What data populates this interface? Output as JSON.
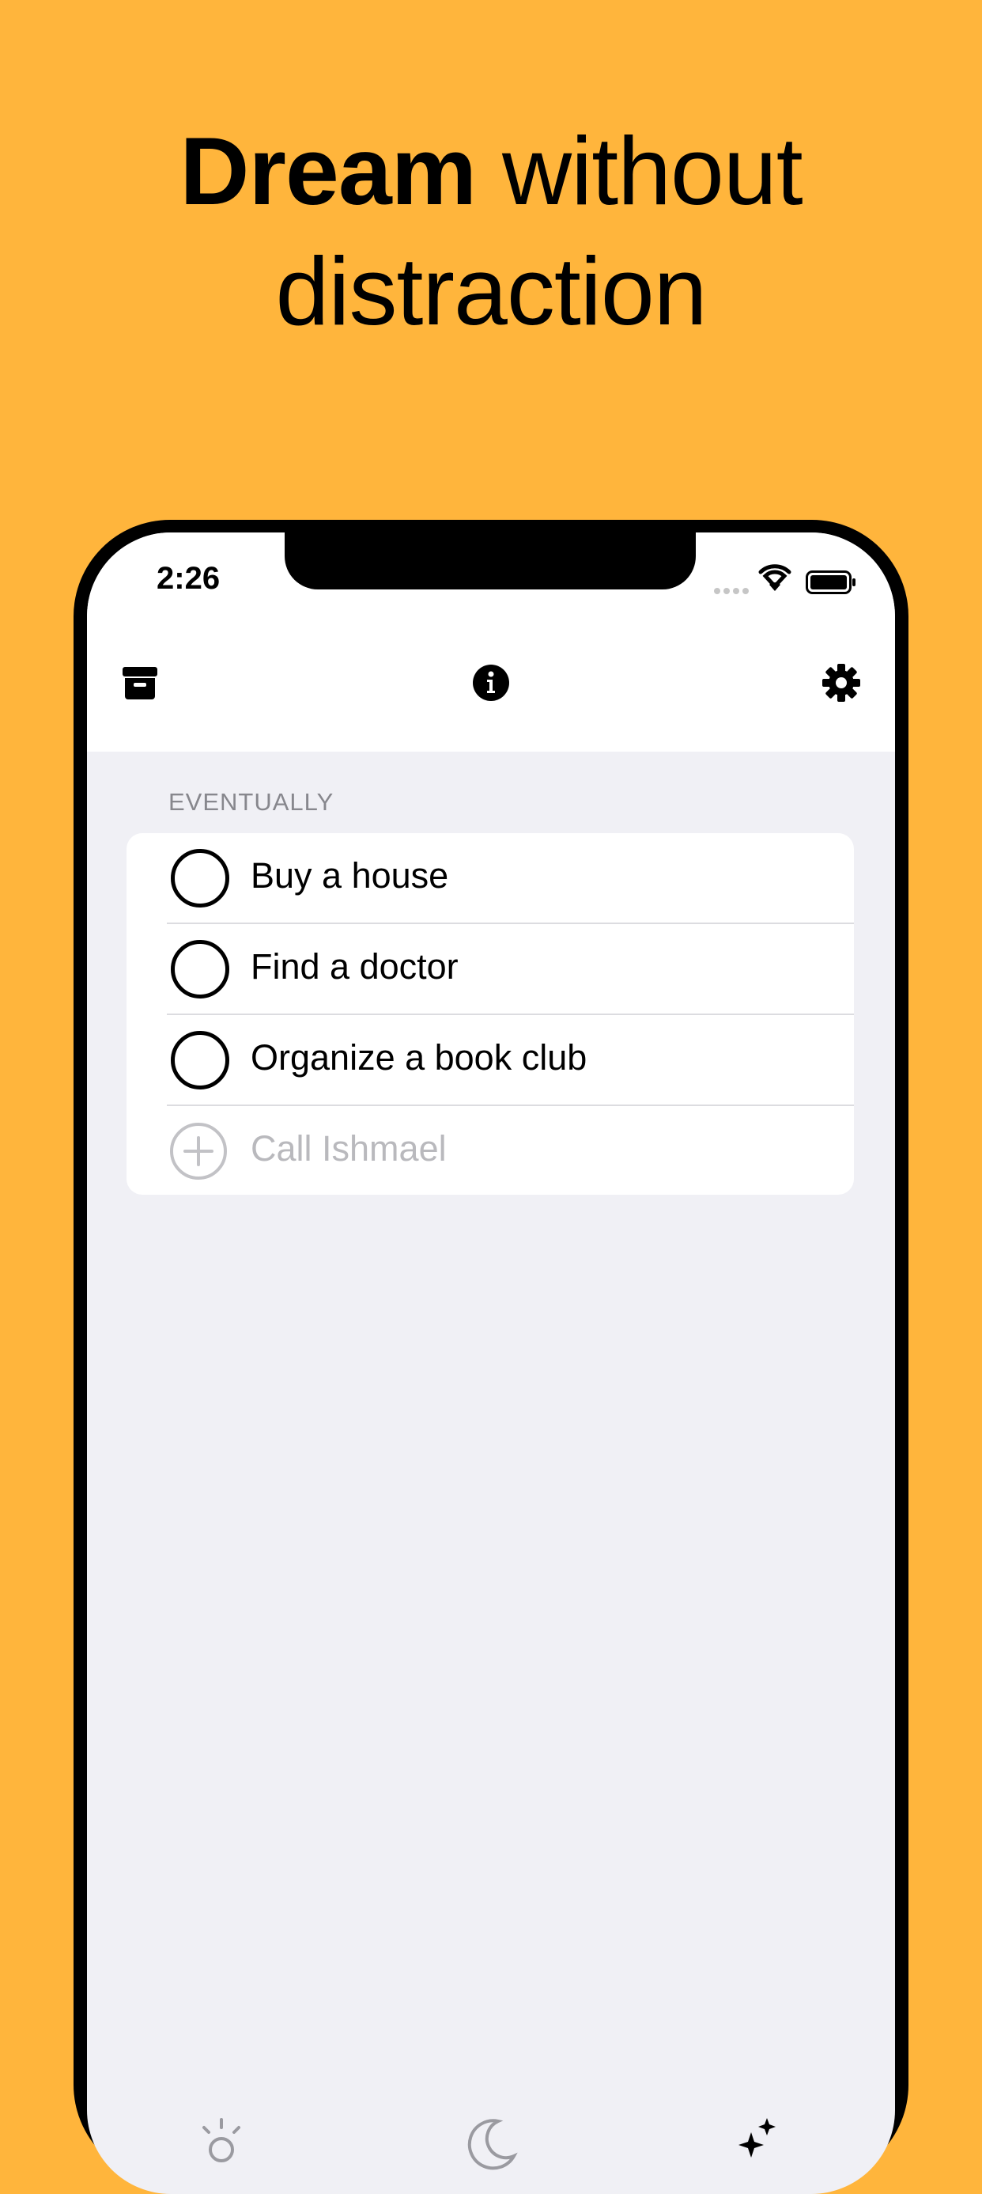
{
  "headline": {
    "bold": "Dream",
    "rest": " without distraction"
  },
  "status_bar": {
    "time": "2:26"
  },
  "toolbar": {
    "left_icon": "archive-box-icon",
    "center_icon": "info-circle-icon",
    "right_icon": "gear-icon"
  },
  "section": {
    "header": "EVENTUALLY",
    "items": [
      {
        "label": "Buy a house"
      },
      {
        "label": "Find a doctor"
      },
      {
        "label": "Organize a book club"
      }
    ],
    "add_placeholder": "Call Ishmael"
  },
  "tab_bar": {
    "icons": [
      "sun-icon",
      "moon-icon",
      "sparkle-icon"
    ]
  },
  "colors": {
    "background": "#FFB53C",
    "screen_background": "#F0F0F5",
    "text": "#000000",
    "secondary_text": "#87878D",
    "placeholder": "#B9B9BD"
  }
}
